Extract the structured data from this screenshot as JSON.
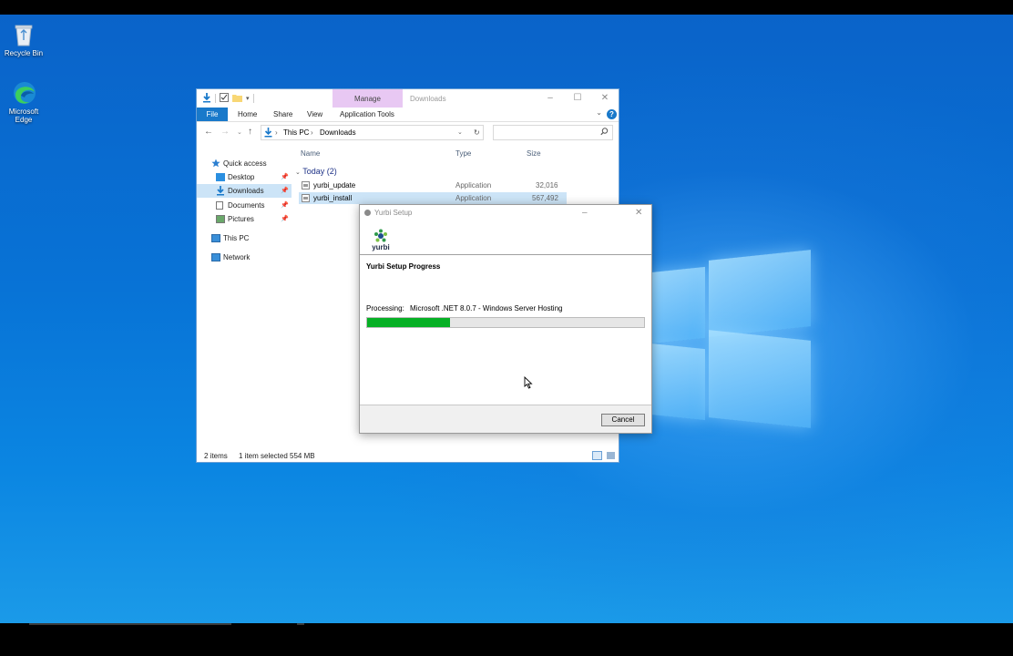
{
  "desktop": {
    "icons": [
      {
        "label": "Recycle Bin",
        "icon": "recycle-bin-icon"
      },
      {
        "label": "Microsoft Edge",
        "icon": "edge-icon"
      }
    ]
  },
  "explorer": {
    "title": "Downloads",
    "manage_tab": "Manage",
    "ribbon_tabs": [
      "File",
      "Home",
      "Share",
      "View",
      "Application Tools"
    ],
    "help_glyph": "?",
    "breadcrumb": [
      "This PC",
      "Downloads"
    ],
    "search_placeholder": "",
    "nav": {
      "quick_access": "Quick access",
      "desktop": "Desktop",
      "downloads": "Downloads",
      "documents": "Documents",
      "pictures": "Pictures",
      "this_pc": "This PC",
      "network": "Network"
    },
    "columns": {
      "name": "Name",
      "type": "Type",
      "size": "Size"
    },
    "group_label": "Today (2)",
    "files": [
      {
        "name": "yurbi_update",
        "type": "Application",
        "size": "32,016 KB",
        "selected": false
      },
      {
        "name": "yurbi_install",
        "type": "Application",
        "size": "567,492 KB",
        "selected": true
      }
    ],
    "status": {
      "items": "2 items",
      "selected": "1 item selected  554 MB"
    }
  },
  "setup": {
    "title": "Yurbi Setup",
    "logo_text": "yurbi",
    "heading": "Yurbi Setup Progress",
    "processing_label": "Processing:",
    "processing_value": "Microsoft .NET 8.0.7 - Windows Server Hosting",
    "progress_fraction": 0.3,
    "cancel_label": "Cancel"
  },
  "colors": {
    "accent": "#1979ca",
    "manage_tab": "#e8c8f3",
    "progress": "#06b025",
    "selection": "#cce4f7"
  }
}
